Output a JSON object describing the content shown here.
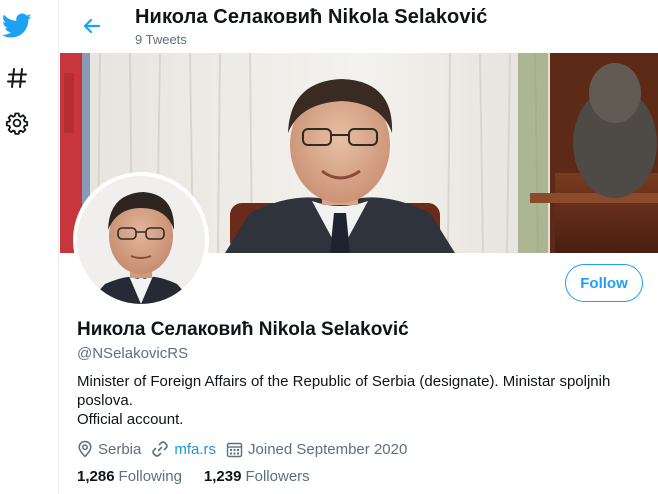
{
  "nav": {
    "icons": [
      "twitter-logo-icon",
      "hashtag-icon",
      "gear-icon"
    ]
  },
  "header": {
    "title": "Никола Селаковић Nikola Selaković",
    "tweet_count": "9 Tweets"
  },
  "profile": {
    "display_name": "Никола Селаковић Nikola Selaković",
    "handle": "@NSelakovicRS",
    "bio_line1": "Minister of Foreign Affairs of the Republic of Serbia (designate). Ministar spoljnih poslova.",
    "bio_line2": "Official account.",
    "location": "Serbia",
    "website": "mfa.rs",
    "joined": "Joined September 2020",
    "following_count": "1,286",
    "following_label": "Following",
    "followers_count": "1,239",
    "followers_label": "Followers"
  },
  "actions": {
    "follow_label": "Follow"
  },
  "colors": {
    "accent": "#1da1f2",
    "link": "#1b95e0",
    "muted": "#5b7083",
    "text": "#0f1419"
  }
}
